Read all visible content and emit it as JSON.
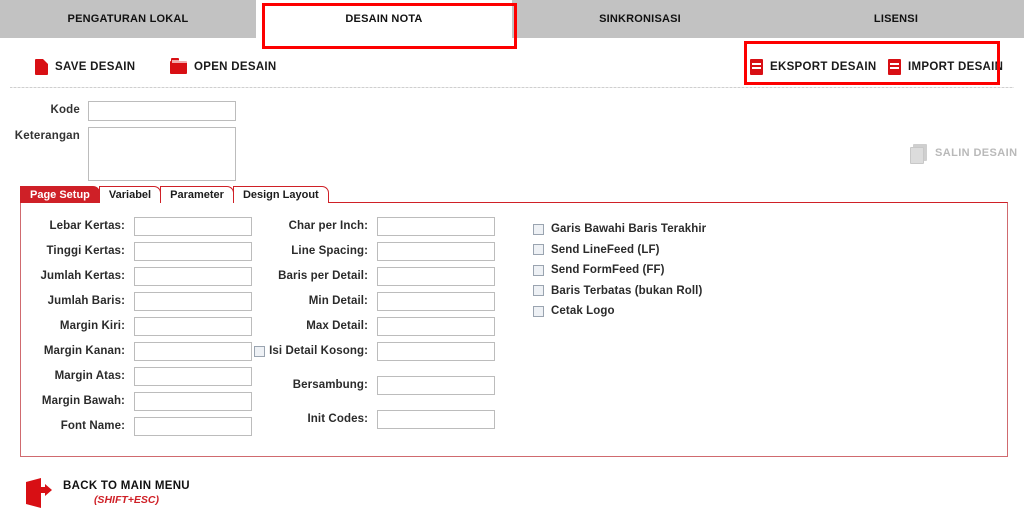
{
  "topnav": {
    "items": [
      {
        "label": "PENGATURAN LOKAL",
        "active": false
      },
      {
        "label": "DESAIN NOTA",
        "active": true
      },
      {
        "label": "SINKRONISASI",
        "active": false
      },
      {
        "label": "LISENSI",
        "active": false
      }
    ]
  },
  "toolbar": {
    "save_label": "SAVE DESAIN",
    "save_icon": "document-icon",
    "open_label": "OPEN DESAIN",
    "open_icon": "folder-icon",
    "eksport_label": "EKSPORT DESAIN",
    "eksport_icon": "document-export-icon",
    "import_label": "IMPORT DESAIN",
    "import_icon": "document-import-icon"
  },
  "header_form": {
    "kode_label": "Kode",
    "kode_value": "",
    "kode_placeholder": "",
    "keterangan_label": "Keterangan",
    "keterangan_value": "",
    "keterangan_placeholder": "",
    "salin_label": "SALIN DESAIN",
    "salin_icon": "copy-document-icon",
    "salin_disabled": true
  },
  "tabs": [
    {
      "label": "Page Setup",
      "active": true
    },
    {
      "label": "Variabel",
      "active": false
    },
    {
      "label": "Parameter",
      "active": false
    },
    {
      "label": "Design Layout",
      "active": false
    }
  ],
  "page_setup": {
    "column_left": [
      {
        "label": "Lebar Kertas:",
        "value": ""
      },
      {
        "label": "Tinggi Kertas:",
        "value": ""
      },
      {
        "label": "Jumlah Kertas:",
        "value": ""
      },
      {
        "label": "Jumlah Baris:",
        "value": ""
      },
      {
        "label": "Margin Kiri:",
        "value": ""
      },
      {
        "label": "Margin Kanan:",
        "value": ""
      },
      {
        "label": "Margin Atas:",
        "value": ""
      },
      {
        "label": "Margin Bawah:",
        "value": ""
      },
      {
        "label": "Font Name:",
        "value": ""
      }
    ],
    "column_middle": [
      {
        "label": "Char per Inch:",
        "value": "",
        "checkbox": false
      },
      {
        "label": "Line Spacing:",
        "value": "",
        "checkbox": false
      },
      {
        "label": "Baris per Detail:",
        "value": "",
        "checkbox": false
      },
      {
        "label": "Min Detail:",
        "value": "",
        "checkbox": false
      },
      {
        "label": "Max Detail:",
        "value": "",
        "checkbox": false
      },
      {
        "label": "Isi Detail Kosong:",
        "value": "",
        "checkbox": true,
        "checked": false
      },
      {
        "label": "Bersambung:",
        "value": "",
        "checkbox": false
      },
      {
        "label": "Init Codes:",
        "value": "",
        "checkbox": false
      }
    ],
    "checkboxes": [
      {
        "label": "Garis Bawahi Baris Terakhir",
        "checked": false
      },
      {
        "label": "Send LineFeed (LF)",
        "checked": false
      },
      {
        "label": "Send FormFeed (FF)",
        "checked": false
      },
      {
        "label": "Baris Terbatas (bukan Roll)",
        "checked": false
      },
      {
        "label": "Cetak Logo",
        "checked": false
      }
    ]
  },
  "footer": {
    "back_label": "BACK TO MAIN MENU",
    "back_shortcut": "(SHIFT+ESC)",
    "back_icon": "exit-door-icon"
  },
  "annotations": [
    {
      "name": "highlight-desain-nota-tab"
    },
    {
      "name": "highlight-export-import-group"
    }
  ],
  "colors": {
    "brand_red": "#cf2027",
    "icon_red": "#d80f14",
    "annotation_red": "#fd0000",
    "nav_grey": "#c2c2c2",
    "disabled_grey": "#b9b9b9"
  }
}
